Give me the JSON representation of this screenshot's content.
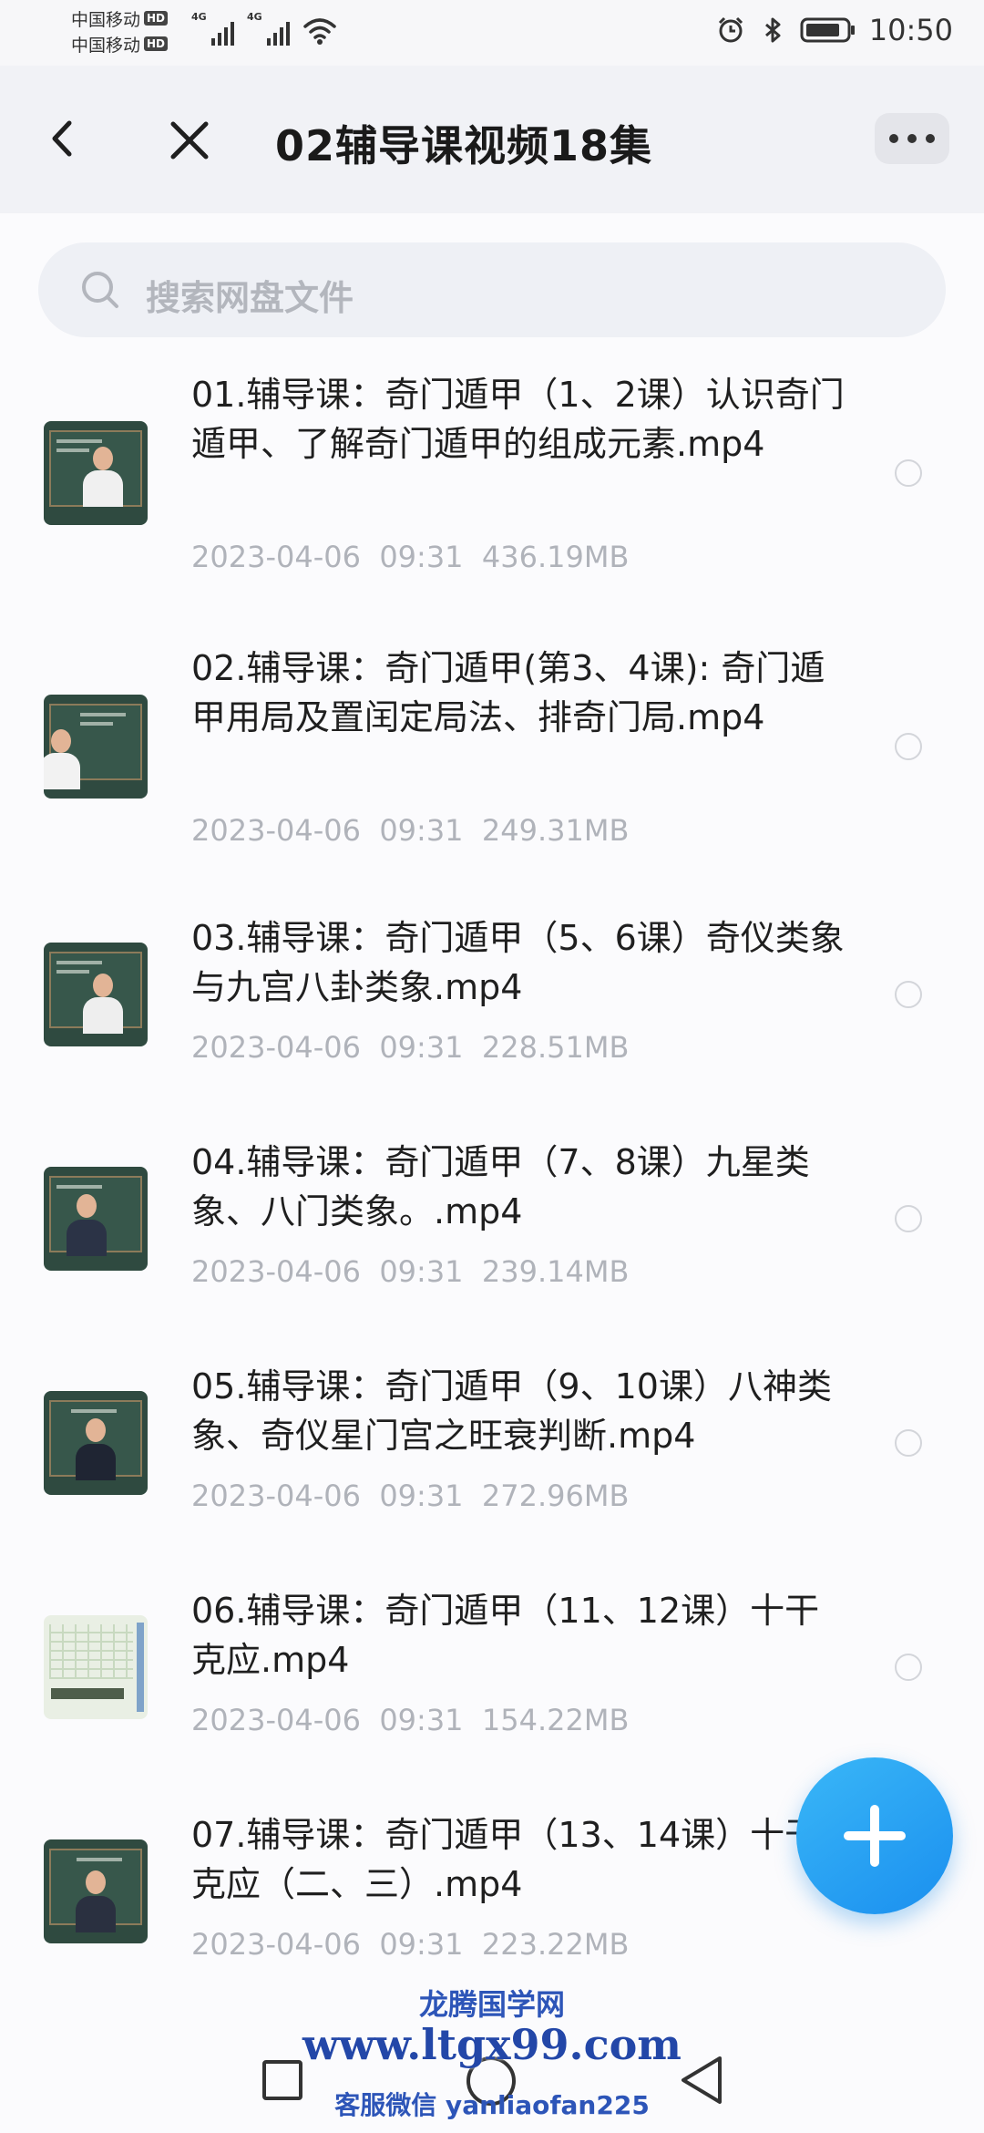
{
  "status_bar": {
    "carrier1": "中国移动",
    "carrier2": "中国移动",
    "hd_badge": "HD",
    "network1": "4G",
    "network2": "4G",
    "time": "10:50",
    "icons": [
      "alarm-icon",
      "bluetooth-icon",
      "battery-icon",
      "wifi-icon",
      "signal-icon"
    ]
  },
  "header": {
    "title": "02辅导课视频18集",
    "icons": [
      "back-arrow-icon",
      "close-icon",
      "more-icon"
    ]
  },
  "search": {
    "placeholder": "搜索网盘文件"
  },
  "files": [
    {
      "name": "01.辅导课：奇门遁甲（1、2课）认识奇门遁甲、了解奇门遁甲的组成元素.mp4",
      "meta": "2023-04-06  09:31  436.19MB"
    },
    {
      "name": "02.辅导课：奇门遁甲(第3、4课): 奇门遁甲用局及置闰定局法、排奇门局.mp4",
      "meta": "2023-04-06  09:31  249.31MB"
    },
    {
      "name": "03.辅导课：奇门遁甲（5、6课）奇仪类象与九宫八卦类象.mp4",
      "meta": "2023-04-06  09:31  228.51MB"
    },
    {
      "name": "04.辅导课：奇门遁甲（7、8课）九星类象、八门类象。.mp4",
      "meta": "2023-04-06  09:31  239.14MB"
    },
    {
      "name": "05.辅导课：奇门遁甲（9、10课）八神类象、奇仪星门宫之旺衰判断.mp4",
      "meta": "2023-04-06  09:31  272.96MB"
    },
    {
      "name": "06.辅导课：奇门遁甲（11、12课）十干克应.mp4",
      "meta": "2023-04-06  09:31  154.22MB"
    },
    {
      "name": "07.辅导课：奇门遁甲（13、14课）十干克应（二、三）.mp4",
      "meta": "2023-04-06  09:31  223.22MB"
    }
  ],
  "fab": {
    "icon": "plus-icon"
  },
  "watermark": {
    "line1": "龙腾国学网",
    "line2": "www.ltgx99.com",
    "line3": "客服微信 yanliaofan225"
  },
  "colors": {
    "accent": "#1a8fef",
    "meta_text": "#b0b3ba",
    "title_bar": "#f1f2f6",
    "watermark": "#2347a8"
  }
}
